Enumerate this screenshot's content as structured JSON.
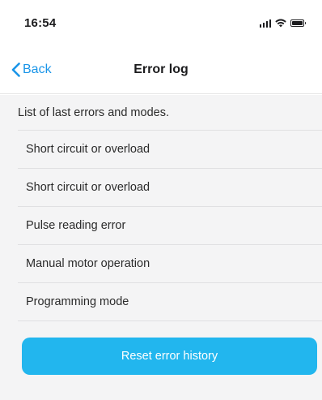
{
  "status_bar": {
    "time": "16:54",
    "icons": [
      "signal-icon",
      "wifi-icon",
      "battery-icon"
    ]
  },
  "nav": {
    "back_label": "Back",
    "back_icon": "chevron-left-icon",
    "title": "Error log"
  },
  "content": {
    "description": "List of last errors and modes.",
    "errors": [
      "Short circuit or overload",
      "Short circuit or overload",
      "Pulse reading error",
      "Manual motor operation",
      "Programming mode"
    ],
    "reset_label": "Reset error history"
  },
  "colors": {
    "accent": "#1a95e8",
    "button": "#22b6ee",
    "background": "#f4f4f5"
  }
}
